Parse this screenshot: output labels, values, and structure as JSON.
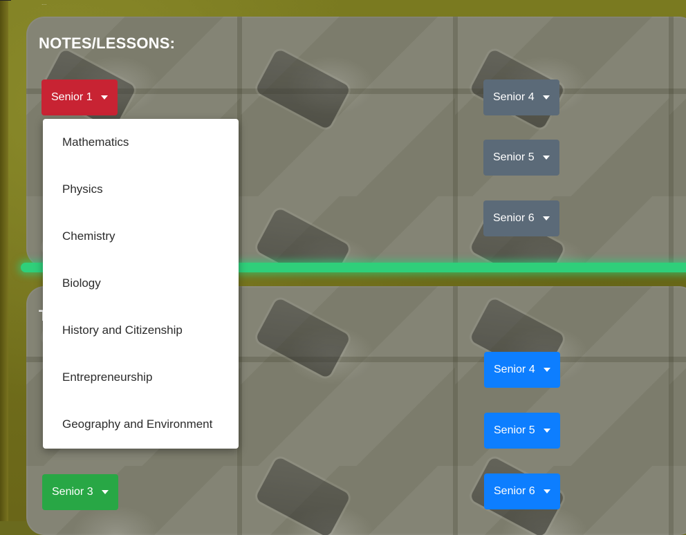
{
  "header_fragment": "...",
  "notes_section": {
    "title": "NOTES/LESSONS:",
    "buttons": [
      {
        "label": "Senior 1",
        "variant": "danger",
        "state": "open"
      },
      {
        "label": "Senior 4",
        "variant": "secondary"
      },
      {
        "label": "Senior 5",
        "variant": "secondary"
      },
      {
        "label": "Senior 6",
        "variant": "secondary"
      }
    ]
  },
  "second_section": {
    "title_partial": "T",
    "buttons": [
      {
        "label": "Senior 4",
        "variant": "primary"
      },
      {
        "label": "Senior 5",
        "variant": "primary"
      },
      {
        "label": "Senior 6",
        "variant": "primary"
      },
      {
        "label": "Senior 3",
        "variant": "success"
      }
    ]
  },
  "dropdown": {
    "items": [
      "Mathematics",
      "Physics",
      "Chemistry",
      "Biology",
      "History and Citizenship",
      "Entrepreneurship",
      "Geography and Environment"
    ]
  },
  "colors": {
    "danger": "#c82333",
    "secondary": "#5b6a78",
    "primary": "#0d7eff",
    "success": "#28a745",
    "divider_glow": "#2fcf7a"
  }
}
